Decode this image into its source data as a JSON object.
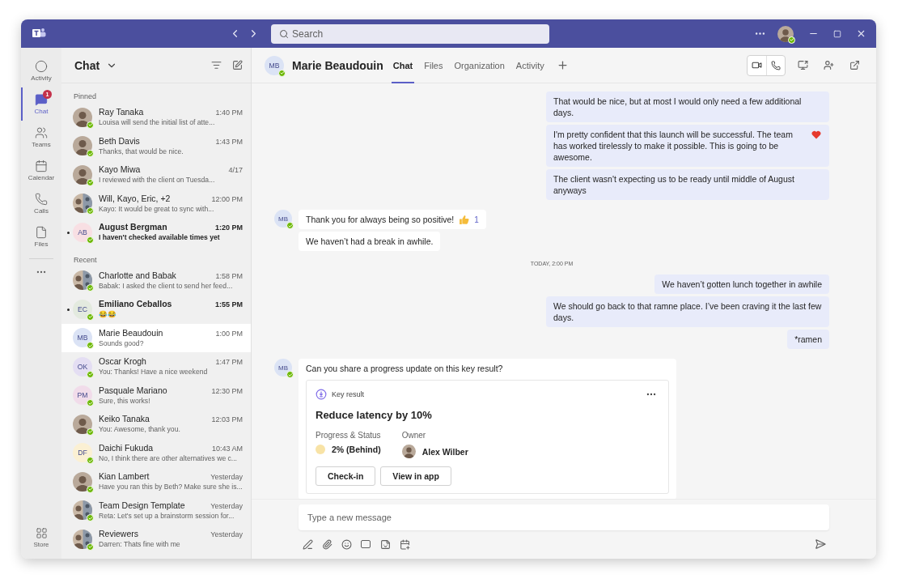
{
  "title_bar": {
    "search": {
      "placeholder": "Search"
    }
  },
  "rail": {
    "items": [
      {
        "label": "Activity",
        "selected": false
      },
      {
        "label": "Chat",
        "selected": true,
        "badge": "1"
      },
      {
        "label": "Teams",
        "selected": false
      },
      {
        "label": "Calendar",
        "selected": false
      },
      {
        "label": "Calls",
        "selected": false
      },
      {
        "label": "Files",
        "selected": false
      }
    ],
    "bottom": {
      "label": "Store",
      "selected": false
    }
  },
  "chat_list": {
    "title": "Chat",
    "sections": [
      {
        "label": "Pinned",
        "items": [
          {
            "name": "Ray Tanaka",
            "preview": "Louisa will send the initial list of atte...",
            "time": "1:40 PM",
            "avatar": {
              "kind": "photo"
            },
            "unread": false,
            "selected": false
          },
          {
            "name": "Beth Davis",
            "preview": "Thanks, that would be nice.",
            "time": "1:43 PM",
            "avatar": {
              "kind": "photo"
            },
            "unread": false,
            "selected": false
          },
          {
            "name": "Kayo Miwa",
            "preview": "I reviewed with the client on Tuesda...",
            "time": "4/17",
            "avatar": {
              "kind": "photo"
            },
            "unread": false,
            "selected": false
          },
          {
            "name": "Will, Kayo, Eric, +2",
            "preview": "Kayo: It would be great to sync with...",
            "time": "12:00 PM",
            "avatar": {
              "kind": "group"
            },
            "unread": false,
            "selected": false
          },
          {
            "name": "August Bergman",
            "preview": "I haven't checked available times yet",
            "time": "1:20 PM",
            "avatar": {
              "kind": "initials",
              "text": "AB",
              "color": "#f8dfe3"
            },
            "unread": true,
            "selected": false
          }
        ]
      },
      {
        "label": "Recent",
        "items": [
          {
            "name": "Charlotte and Babak",
            "preview": "Babak: I asked the client to send her feed...",
            "time": "1:58 PM",
            "avatar": {
              "kind": "group"
            },
            "unread": false,
            "selected": false
          },
          {
            "name": "Emiliano Ceballos",
            "preview": "😂😂",
            "time": "1:55 PM",
            "avatar": {
              "kind": "initials",
              "text": "EC",
              "color": "#e3eadf"
            },
            "unread": true,
            "selected": false
          },
          {
            "name": "Marie Beaudouin",
            "preview": "Sounds good?",
            "time": "1:00 PM",
            "avatar": {
              "kind": "initials",
              "text": "MB",
              "color": "#dbe3f5"
            },
            "unread": false,
            "selected": true
          },
          {
            "name": "Oscar Krogh",
            "preview": "You: Thanks! Have a nice weekend",
            "time": "1:47 PM",
            "avatar": {
              "kind": "initials",
              "text": "OK",
              "color": "#e4def3"
            },
            "unread": false,
            "selected": false
          },
          {
            "name": "Pasquale Mariano",
            "preview": "Sure, this works!",
            "time": "12:30 PM",
            "avatar": {
              "kind": "initials",
              "text": "PM",
              "color": "#f1dcea"
            },
            "unread": false,
            "selected": false
          },
          {
            "name": "Keiko Tanaka",
            "preview": "You: Awesome, thank you.",
            "time": "12:03 PM",
            "avatar": {
              "kind": "photo"
            },
            "unread": false,
            "selected": false
          },
          {
            "name": "Daichi Fukuda",
            "preview": "No, I think there are other alternatives we c...",
            "time": "10:43 AM",
            "avatar": {
              "kind": "initials",
              "text": "DF",
              "color": "#fbf0d3"
            },
            "unread": false,
            "selected": false
          },
          {
            "name": "Kian Lambert",
            "preview": "Have you ran this by Beth? Make sure she is...",
            "time": "Yesterday",
            "avatar": {
              "kind": "photo"
            },
            "unread": false,
            "selected": false
          },
          {
            "name": "Team Design Template",
            "preview": "Reta: Let's set up a brainstorm session for...",
            "time": "Yesterday",
            "avatar": {
              "kind": "group"
            },
            "unread": false,
            "selected": false
          },
          {
            "name": "Reviewers",
            "preview": "Darren: Thats fine with me",
            "time": "Yesterday",
            "avatar": {
              "kind": "group"
            },
            "unread": false,
            "selected": false
          }
        ]
      }
    ]
  },
  "conversation": {
    "avatar": "MB",
    "name": "Marie Beaudouin",
    "tabs": [
      {
        "label": "Chat",
        "selected": true
      },
      {
        "label": "Files",
        "selected": false
      },
      {
        "label": "Organization",
        "selected": false
      },
      {
        "label": "Activity",
        "selected": false
      }
    ],
    "messages": [
      {
        "kind": "outgoing",
        "text": "That would be nice, but at most I would only need a few additional days."
      },
      {
        "kind": "outgoing",
        "text": "I'm pretty confident that this launch will be successful. The team has worked tirelessly to make it possible. This is going to be awesome.",
        "reaction": {
          "kind": "heart"
        }
      },
      {
        "kind": "outgoing",
        "text": "The client wasn't expecting us to be ready until middle of August anyways"
      },
      {
        "kind": "incoming",
        "avatar": "MB",
        "text": "Thank you for always being so positive!",
        "reaction": {
          "kind": "like",
          "count": "1"
        }
      },
      {
        "kind": "incoming",
        "text": "We haven’t had a break in awhile."
      },
      {
        "kind": "divider",
        "text": "TODAY, 2:00 PM"
      },
      {
        "kind": "outgoing",
        "text": "We haven’t gotten lunch together in awhile"
      },
      {
        "kind": "outgoing",
        "text": "We should go back to that ramne place. I’ve been craving it the last few days."
      },
      {
        "kind": "outgoing",
        "text": "*ramen"
      },
      {
        "kind": "incoming",
        "avatar": "MB",
        "text": "Can you share a progress update on this key result?",
        "card": {
          "label": "Key result",
          "title": "Reduce latency by 10%",
          "status_label": "Progress & Status",
          "status": "2% (Behind)",
          "color": "#f8e3a6",
          "owner_label": "Owner",
          "owner": "Alex Wilber",
          "buttons": [
            "Check-in",
            "View in app"
          ]
        }
      }
    ],
    "composer": {
      "placeholder": "Type a new message"
    }
  }
}
